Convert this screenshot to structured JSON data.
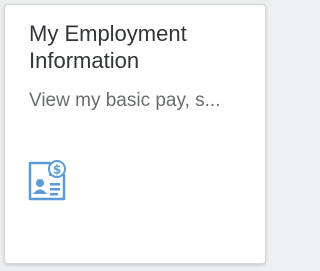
{
  "tile": {
    "title_line1": "My Employment",
    "title_line2": "Information",
    "subtitle": "View my basic pay, s...",
    "icon": "employee-payroll-icon",
    "icon_color": "#5b9bd5"
  }
}
